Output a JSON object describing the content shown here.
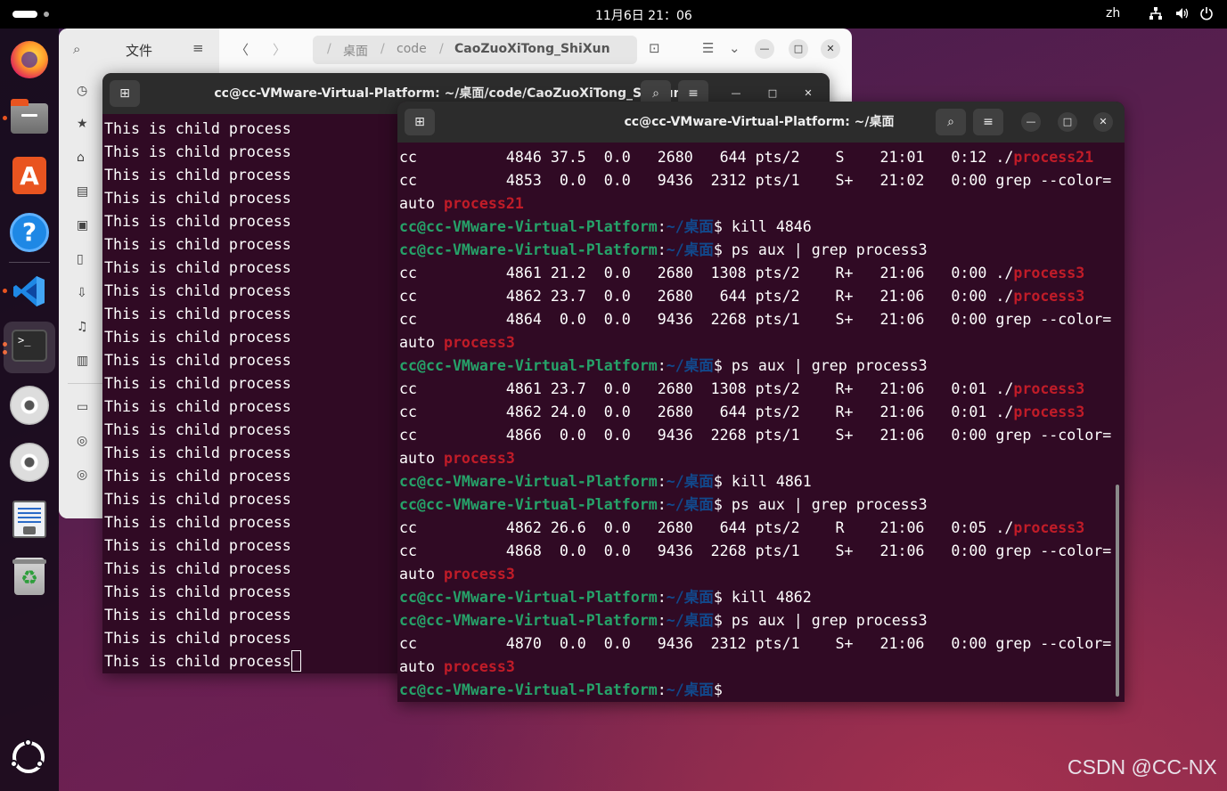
{
  "topbar": {
    "clock": "11月6日  21：06",
    "lang": "zh",
    "icons": [
      "network-icon",
      "volume-icon",
      "power-icon"
    ]
  },
  "dock": {
    "items": [
      "firefox",
      "files",
      "app-center",
      "help",
      "vscode",
      "terminal",
      "disc",
      "disc",
      "document",
      "trash"
    ]
  },
  "files": {
    "title": "文件",
    "path": [
      "桌面",
      "code",
      "CaoZuoXiTong_ShiXun"
    ]
  },
  "term1": {
    "title": "cc@cc-VMware-Virtual-Platform: ~/桌面/code/CaoZuoXiTong_ShiXun",
    "lines": [
      "This is child process",
      "This is child process",
      "This is child process",
      "This is child process",
      "This is child process",
      "This is child process",
      "This is child process",
      "This is child process",
      "This is child process",
      "This is child process",
      "This is child process",
      "This is child process",
      "This is child process",
      "This is child process",
      "This is child process",
      "This is child process",
      "This is child process",
      "This is child process",
      "This is child process",
      "This is child process",
      "This is child process",
      "This is child process",
      "This is child process",
      "This is child process"
    ]
  },
  "term2": {
    "title": "cc@cc-VMware-Virtual-Platform: ~/桌面",
    "prompt_user": "cc@cc-VMware-Virtual-Platform",
    "prompt_path": "~/桌面",
    "lines": [
      {
        "type": "out",
        "text": "cc          4846 37.5  0.0   2680   644 pts/2    S    21:01   0:12 ./",
        "hl": "process21"
      },
      {
        "type": "out",
        "text": "cc          4853  0.0  0.0   9436  2312 pts/1    S+   21:02   0:00 grep --color=",
        "hl": ""
      },
      {
        "type": "out",
        "text": "auto ",
        "hl": "process21"
      },
      {
        "type": "cmd",
        "text": "kill 4846"
      },
      {
        "type": "cmd",
        "text": "ps aux | grep process3"
      },
      {
        "type": "out",
        "text": "cc          4861 21.2  0.0   2680  1308 pts/2    R+   21:06   0:00 ./",
        "hl": "process3"
      },
      {
        "type": "out",
        "text": "cc          4862 23.7  0.0   2680   644 pts/2    R+   21:06   0:00 ./",
        "hl": "process3"
      },
      {
        "type": "out",
        "text": "cc          4864  0.0  0.0   9436  2268 pts/1    S+   21:06   0:00 grep --color=",
        "hl": ""
      },
      {
        "type": "out",
        "text": "auto ",
        "hl": "process3"
      },
      {
        "type": "cmd",
        "text": "ps aux | grep process3"
      },
      {
        "type": "out",
        "text": "cc          4861 23.7  0.0   2680  1308 pts/2    R+   21:06   0:01 ./",
        "hl": "process3"
      },
      {
        "type": "out",
        "text": "cc          4862 24.0  0.0   2680   644 pts/2    R+   21:06   0:01 ./",
        "hl": "process3"
      },
      {
        "type": "out",
        "text": "cc          4866  0.0  0.0   9436  2268 pts/1    S+   21:06   0:00 grep --color=",
        "hl": ""
      },
      {
        "type": "out",
        "text": "auto ",
        "hl": "process3"
      },
      {
        "type": "cmd",
        "text": "kill 4861"
      },
      {
        "type": "cmd",
        "text": "ps aux | grep process3"
      },
      {
        "type": "out",
        "text": "cc          4862 26.6  0.0   2680   644 pts/2    R    21:06   0:05 ./",
        "hl": "process3"
      },
      {
        "type": "out",
        "text": "cc          4868  0.0  0.0   9436  2268 pts/1    S+   21:06   0:00 grep --color=",
        "hl": ""
      },
      {
        "type": "out",
        "text": "auto ",
        "hl": "process3"
      },
      {
        "type": "cmd",
        "text": "kill 4862"
      },
      {
        "type": "cmd",
        "text": "ps aux | grep process3"
      },
      {
        "type": "out",
        "text": "cc          4870  0.0  0.0   9436  2312 pts/1    S+   21:06   0:00 grep --color=",
        "hl": ""
      },
      {
        "type": "out",
        "text": "auto ",
        "hl": "process3"
      },
      {
        "type": "cmd",
        "text": ""
      }
    ]
  },
  "watermark": "CSDN @CC-NX",
  "colors": {
    "terminal_bg": "#300a24",
    "prompt_user": "#26a269",
    "prompt_path": "#12488b",
    "highlight": "#c01c28"
  }
}
